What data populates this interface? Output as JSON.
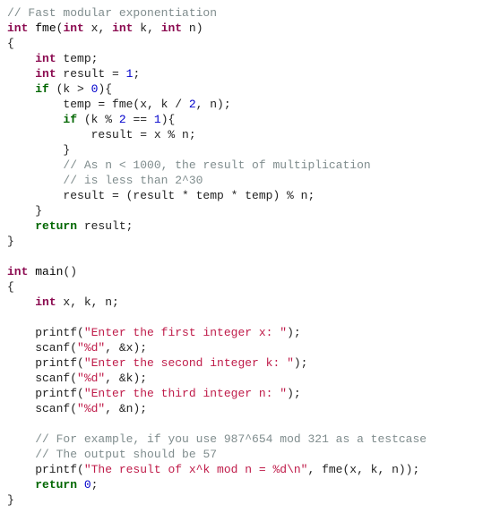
{
  "code": {
    "tokens": [
      [
        {
          "t": "// Fast modular exponentiation",
          "c": "c"
        }
      ],
      [
        {
          "t": "int",
          "c": "ty"
        },
        {
          "t": " ",
          "c": "op"
        },
        {
          "t": "fme",
          "c": "fn"
        },
        {
          "t": "(",
          "c": "op"
        },
        {
          "t": "int",
          "c": "ty"
        },
        {
          "t": " x, ",
          "c": "id"
        },
        {
          "t": "int",
          "c": "ty"
        },
        {
          "t": " k, ",
          "c": "id"
        },
        {
          "t": "int",
          "c": "ty"
        },
        {
          "t": " n)",
          "c": "id"
        }
      ],
      [
        {
          "t": "{",
          "c": "op"
        }
      ],
      [
        {
          "t": "    ",
          "c": "op"
        },
        {
          "t": "int",
          "c": "ty"
        },
        {
          "t": " temp;",
          "c": "id"
        }
      ],
      [
        {
          "t": "    ",
          "c": "op"
        },
        {
          "t": "int",
          "c": "ty"
        },
        {
          "t": " result = ",
          "c": "id"
        },
        {
          "t": "1",
          "c": "num"
        },
        {
          "t": ";",
          "c": "op"
        }
      ],
      [
        {
          "t": "    ",
          "c": "op"
        },
        {
          "t": "if",
          "c": "kw"
        },
        {
          "t": " (k > ",
          "c": "id"
        },
        {
          "t": "0",
          "c": "num"
        },
        {
          "t": "){",
          "c": "op"
        }
      ],
      [
        {
          "t": "        temp = fme(x, k / ",
          "c": "id"
        },
        {
          "t": "2",
          "c": "num"
        },
        {
          "t": ", n);",
          "c": "id"
        }
      ],
      [
        {
          "t": "        ",
          "c": "op"
        },
        {
          "t": "if",
          "c": "kw"
        },
        {
          "t": " (k % ",
          "c": "id"
        },
        {
          "t": "2",
          "c": "num"
        },
        {
          "t": " == ",
          "c": "id"
        },
        {
          "t": "1",
          "c": "num"
        },
        {
          "t": "){",
          "c": "op"
        }
      ],
      [
        {
          "t": "            result = x % n;",
          "c": "id"
        }
      ],
      [
        {
          "t": "        }",
          "c": "op"
        }
      ],
      [
        {
          "t": "        ",
          "c": "op"
        },
        {
          "t": "// As n < 1000, the result of multiplication",
          "c": "c"
        }
      ],
      [
        {
          "t": "        ",
          "c": "op"
        },
        {
          "t": "// is less than 2^30",
          "c": "c"
        }
      ],
      [
        {
          "t": "        result = (result * temp * temp) % n;",
          "c": "id"
        }
      ],
      [
        {
          "t": "    }",
          "c": "op"
        }
      ],
      [
        {
          "t": "    ",
          "c": "op"
        },
        {
          "t": "return",
          "c": "kw"
        },
        {
          "t": " result;",
          "c": "id"
        }
      ],
      [
        {
          "t": "}",
          "c": "op"
        }
      ],
      [
        {
          "t": "",
          "c": "op"
        }
      ],
      [
        {
          "t": "int",
          "c": "ty"
        },
        {
          "t": " ",
          "c": "op"
        },
        {
          "t": "main",
          "c": "fn"
        },
        {
          "t": "()",
          "c": "op"
        }
      ],
      [
        {
          "t": "{",
          "c": "op"
        }
      ],
      [
        {
          "t": "    ",
          "c": "op"
        },
        {
          "t": "int",
          "c": "ty"
        },
        {
          "t": " x, k, n;",
          "c": "id"
        }
      ],
      [
        {
          "t": "",
          "c": "op"
        }
      ],
      [
        {
          "t": "    printf(",
          "c": "id"
        },
        {
          "t": "\"Enter the first integer x: \"",
          "c": "str"
        },
        {
          "t": ");",
          "c": "id"
        }
      ],
      [
        {
          "t": "    scanf(",
          "c": "id"
        },
        {
          "t": "\"%d\"",
          "c": "str"
        },
        {
          "t": ", &x);",
          "c": "id"
        }
      ],
      [
        {
          "t": "    printf(",
          "c": "id"
        },
        {
          "t": "\"Enter the second integer k: \"",
          "c": "str"
        },
        {
          "t": ");",
          "c": "id"
        }
      ],
      [
        {
          "t": "    scanf(",
          "c": "id"
        },
        {
          "t": "\"%d\"",
          "c": "str"
        },
        {
          "t": ", &k);",
          "c": "id"
        }
      ],
      [
        {
          "t": "    printf(",
          "c": "id"
        },
        {
          "t": "\"Enter the third integer n: \"",
          "c": "str"
        },
        {
          "t": ");",
          "c": "id"
        }
      ],
      [
        {
          "t": "    scanf(",
          "c": "id"
        },
        {
          "t": "\"%d\"",
          "c": "str"
        },
        {
          "t": ", &n);",
          "c": "id"
        }
      ],
      [
        {
          "t": "",
          "c": "op"
        }
      ],
      [
        {
          "t": "    ",
          "c": "op"
        },
        {
          "t": "// For example, if you use 987^654 mod 321 as a testcase",
          "c": "c"
        }
      ],
      [
        {
          "t": "    ",
          "c": "op"
        },
        {
          "t": "// The output should be 57",
          "c": "c"
        }
      ],
      [
        {
          "t": "    printf(",
          "c": "id"
        },
        {
          "t": "\"The result of x^k mod n = %d\\n\"",
          "c": "str"
        },
        {
          "t": ", fme(x, k, n));",
          "c": "id"
        }
      ],
      [
        {
          "t": "    ",
          "c": "op"
        },
        {
          "t": "return",
          "c": "kw"
        },
        {
          "t": " ",
          "c": "op"
        },
        {
          "t": "0",
          "c": "num"
        },
        {
          "t": ";",
          "c": "op"
        }
      ],
      [
        {
          "t": "}",
          "c": "op"
        }
      ]
    ]
  }
}
